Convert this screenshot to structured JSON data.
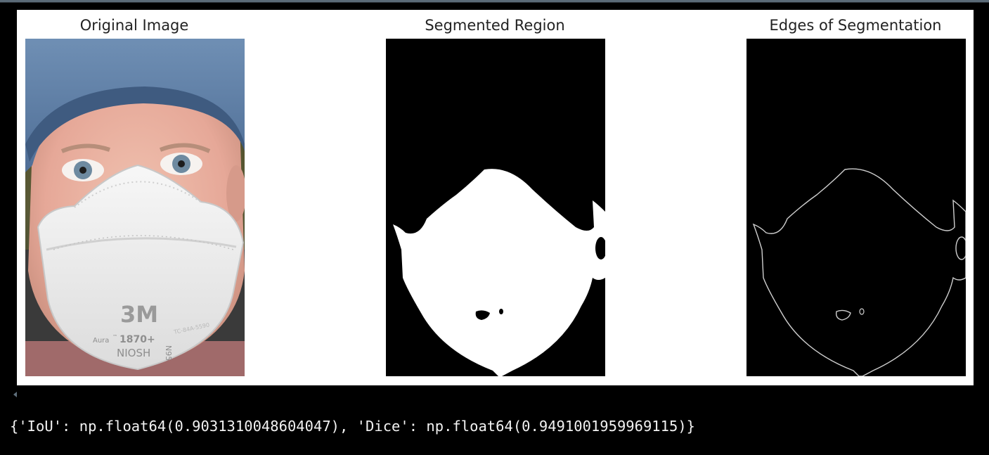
{
  "figure": {
    "panels": [
      {
        "title": "Original Image",
        "image_description": "photo of a man in a blue cap wearing a white 3M respirator mask",
        "mask_text": {
          "brand": "3M",
          "model_left": "Aura",
          "model_tm": "™",
          "model_number": "1870+",
          "cert": "NIOSH",
          "grade": "N95",
          "lot": "TC-84A-5590"
        }
      },
      {
        "title": "Segmented Region"
      },
      {
        "title": "Edges of Segmentation"
      }
    ]
  },
  "output": {
    "text": "{'IoU': np.float64(0.9031310048604047), 'Dice': np.float64(0.9491001959969115)}"
  },
  "colors": {
    "page_background": "#000000",
    "figure_background": "#ffffff",
    "mask_fill": "#ffffff",
    "mask_background": "#000000",
    "edge_stroke": "#cfcfcf",
    "output_text": "#f2f2f2"
  }
}
